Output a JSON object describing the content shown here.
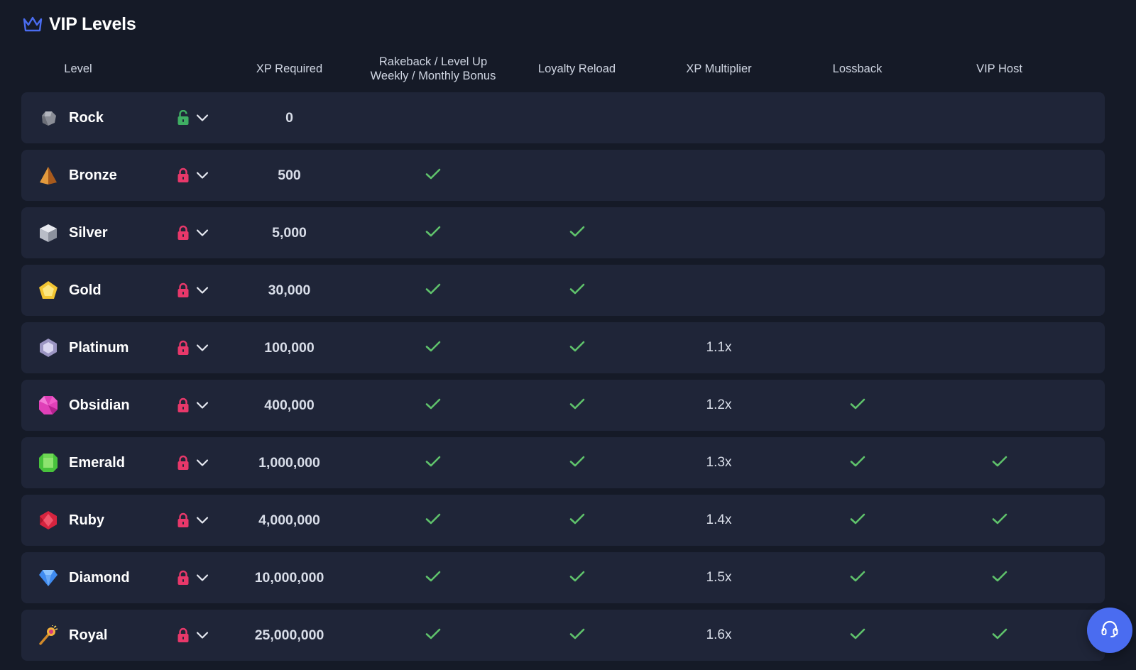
{
  "page": {
    "title": "VIP Levels",
    "title_icon": "crown-icon",
    "accent_color": "#4a6cf0"
  },
  "columns": {
    "level": "Level",
    "xp_required": "XP Required",
    "rakeback_line1": "Rakeback / Level Up",
    "rakeback_line2": "Weekly / Monthly Bonus",
    "loyalty_reload": "Loyalty Reload",
    "xp_multiplier": "XP Multiplier",
    "lossback": "Lossback",
    "vip_host": "VIP Host"
  },
  "colors": {
    "check": "#5fc26b",
    "lock_unlocked": "#3fae63",
    "lock_locked": "#e8386a"
  },
  "levels": [
    {
      "name": "Rock",
      "icon": "rock-icon",
      "xp": "0",
      "locked": false,
      "rakeback": false,
      "loyalty": false,
      "multiplier": "",
      "lossback": false,
      "host": false
    },
    {
      "name": "Bronze",
      "icon": "bronze-pyramid-icon",
      "xp": "500",
      "locked": true,
      "rakeback": true,
      "loyalty": false,
      "multiplier": "",
      "lossback": false,
      "host": false
    },
    {
      "name": "Silver",
      "icon": "silver-cube-icon",
      "xp": "5,000",
      "locked": true,
      "rakeback": true,
      "loyalty": true,
      "multiplier": "",
      "lossback": false,
      "host": false
    },
    {
      "name": "Gold",
      "icon": "gold-pentagon-icon",
      "xp": "30,000",
      "locked": true,
      "rakeback": true,
      "loyalty": true,
      "multiplier": "",
      "lossback": false,
      "host": false
    },
    {
      "name": "Platinum",
      "icon": "platinum-hexagon-icon",
      "xp": "100,000",
      "locked": true,
      "rakeback": true,
      "loyalty": true,
      "multiplier": "1.1x",
      "lossback": false,
      "host": false
    },
    {
      "name": "Obsidian",
      "icon": "obsidian-gem-icon",
      "xp": "400,000",
      "locked": true,
      "rakeback": true,
      "loyalty": true,
      "multiplier": "1.2x",
      "lossback": true,
      "host": false
    },
    {
      "name": "Emerald",
      "icon": "emerald-gem-icon",
      "xp": "1,000,000",
      "locked": true,
      "rakeback": true,
      "loyalty": true,
      "multiplier": "1.3x",
      "lossback": true,
      "host": true
    },
    {
      "name": "Ruby",
      "icon": "ruby-gem-icon",
      "xp": "4,000,000",
      "locked": true,
      "rakeback": true,
      "loyalty": true,
      "multiplier": "1.4x",
      "lossback": true,
      "host": true
    },
    {
      "name": "Diamond",
      "icon": "diamond-icon",
      "xp": "10,000,000",
      "locked": true,
      "rakeback": true,
      "loyalty": true,
      "multiplier": "1.5x",
      "lossback": true,
      "host": true
    },
    {
      "name": "Royal",
      "icon": "royal-scepter-icon",
      "xp": "25,000,000",
      "locked": true,
      "rakeback": true,
      "loyalty": true,
      "multiplier": "1.6x",
      "lossback": true,
      "host": true
    }
  ],
  "support": {
    "icon": "headset-icon"
  }
}
